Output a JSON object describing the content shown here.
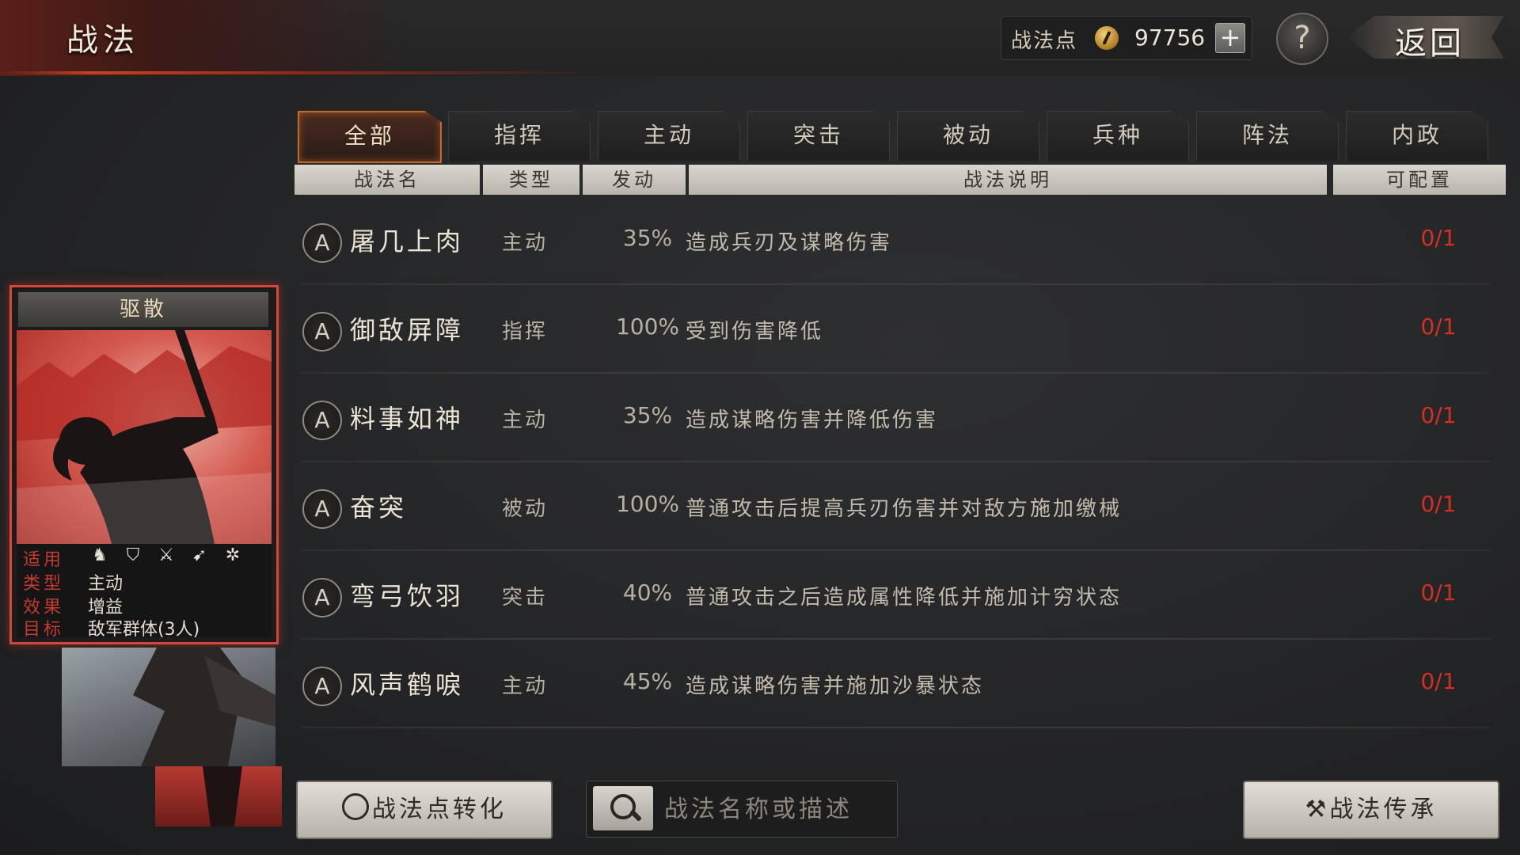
{
  "header": {
    "title": "战法",
    "points_label": "战法点",
    "points_value": "97756",
    "plus": "+",
    "help": "?",
    "back": "返回"
  },
  "tabs": [
    {
      "label": "全部",
      "active": true
    },
    {
      "label": "指挥",
      "active": false
    },
    {
      "label": "主动",
      "active": false
    },
    {
      "label": "突击",
      "active": false
    },
    {
      "label": "被动",
      "active": false
    },
    {
      "label": "兵种",
      "active": false
    },
    {
      "label": "阵法",
      "active": false
    },
    {
      "label": "内政",
      "active": false
    }
  ],
  "columns": {
    "name": "战法名",
    "type": "类型",
    "trigger": "发动",
    "desc": "战法说明",
    "config": "可配置"
  },
  "skills": [
    {
      "grade": "A",
      "name": "屠几上肉",
      "type": "主动",
      "rate": "35%",
      "desc": "造成兵刃及谋略伤害",
      "count": "0/1"
    },
    {
      "grade": "A",
      "name": "御敌屏障",
      "type": "指挥",
      "rate": "100%",
      "desc": "受到伤害降低",
      "count": "0/1"
    },
    {
      "grade": "A",
      "name": "料事如神",
      "type": "主动",
      "rate": "35%",
      "desc": "造成谋略伤害并降低伤害",
      "count": "0/1"
    },
    {
      "grade": "A",
      "name": "奋突",
      "type": "被动",
      "rate": "100%",
      "desc": "普通攻击后提高兵刃伤害并对敌方施加缴械",
      "count": "0/1"
    },
    {
      "grade": "A",
      "name": "弯弓饮羽",
      "type": "突击",
      "rate": "40%",
      "desc": "普通攻击之后造成属性降低并施加计穷状态",
      "count": "0/1"
    },
    {
      "grade": "A",
      "name": "风声鹤唳",
      "type": "主动",
      "rate": "45%",
      "desc": "造成谋略伤害并施加沙暴状态",
      "count": "0/1"
    }
  ],
  "card": {
    "title": "驱散",
    "applies_key": "适用",
    "applies_icons": [
      "cavalry-icon",
      "shield-icon",
      "crossed-swords-icon",
      "spear-icon",
      "wheel-icon"
    ],
    "type_key": "类型",
    "type_val": "主动",
    "effect_key": "效果",
    "effect_val": "增益",
    "target_key": "目标",
    "target_val": "敌军群体(3人)"
  },
  "bottom": {
    "convert_label": "战法点转化",
    "search_placeholder": "战法名称或描述",
    "inherit_label": "战法传承"
  },
  "colors": {
    "accent_red": "#d52e24",
    "tab_active_border": "#c36a2a",
    "card_border": "#d7463a"
  }
}
